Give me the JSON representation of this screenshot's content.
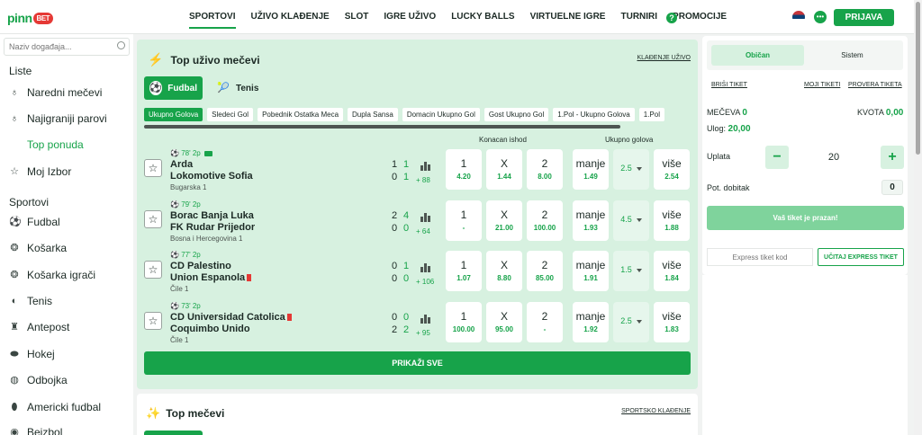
{
  "header": {
    "logo_text": "pinn",
    "logo_badge": "BET",
    "nav": [
      "SPORTOVI",
      "UŽIVO KLAĐENJE",
      "SLOT",
      "IGRE UŽIVO",
      "LUCKY BALLS",
      "VIRTUELNE IGRE",
      "TURNIRI",
      "PROMOCIJE"
    ],
    "help_glyph": "?",
    "login_label": "PRIJAVA"
  },
  "sidebar": {
    "search_placeholder": "Naziv događaja...",
    "lists_title": "Liste",
    "list_items": [
      "Naredni mečevi",
      "Najigraniji parovi",
      "Top ponuda",
      "Moj Izbor"
    ],
    "sports_title": "Sportovi",
    "sports": [
      "Fudbal",
      "Košarka",
      "Košarka igrači",
      "Tenis",
      "Antepost",
      "Hokej",
      "Odbojka",
      "Americki fudbal",
      "Bejzbol"
    ]
  },
  "live": {
    "title": "Top uživo mečevi",
    "link": "KLAĐENJE UŽIVO",
    "sports": [
      "Fudbal",
      "Tenis"
    ],
    "market_tabs": [
      "Ukupno Golova",
      "Sledeci Gol",
      "Pobednik Ostatka Meca",
      "Dupla Sansa",
      "Domacin Ukupno Gol",
      "Gost Ukupno Gol",
      "1.Pol - Ukupno Golova",
      "1.Pol"
    ],
    "col_final": "Konacan ishod",
    "col_goals": "Ukupno golova",
    "matches": [
      {
        "time": "78' 2p",
        "home": "Arda",
        "away": "Lokomotive Sofia",
        "league": "Bugarska 1",
        "h1": "1",
        "h2": "1",
        "a1": "0",
        "a2": "1",
        "more": "+ 88",
        "o1": "4.20",
        "ox": "1.44",
        "o2": "8.00",
        "under": "1.49",
        "line": "2.5",
        "over": "2.54"
      },
      {
        "time": "79' 2p",
        "home": "Borac Banja Luka",
        "away": "FK Rudar Prijedor",
        "league": "Bosna i Hercegovina 1",
        "h1": "2",
        "h2": "4",
        "a1": "0",
        "a2": "0",
        "more": "+ 64",
        "o1": "-",
        "ox": "21.00",
        "o2": "100.00",
        "under": "1.93",
        "line": "4.5",
        "over": "1.88"
      },
      {
        "time": "77' 2p",
        "home": "CD Palestino",
        "away": "Union Espanola",
        "league": "Čile 1",
        "h1": "0",
        "h2": "1",
        "a1": "0",
        "a2": "0",
        "more": "+ 106",
        "o1": "1.07",
        "ox": "8.80",
        "o2": "85.00",
        "under": "1.91",
        "line": "1.5",
        "over": "1.84"
      },
      {
        "time": "73' 2p",
        "home": "CD Universidad Catolica",
        "away": "Coquimbo Unido",
        "league": "Čile 1",
        "h1": "0",
        "h2": "0",
        "a1": "2",
        "a2": "2",
        "more": "+ 95",
        "o1": "100.00",
        "ox": "95.00",
        "o2": "-",
        "under": "1.92",
        "line": "2.5",
        "over": "1.83"
      }
    ],
    "label_1": "1",
    "label_x": "X",
    "label_2": "2",
    "label_under": "manje",
    "label_over": "više",
    "show_all": "PRIKAŽI SVE"
  },
  "top": {
    "title": "Top mečevi",
    "link": "SPORTSKO KLAĐENJE"
  },
  "ticket": {
    "tabs": [
      "Običan",
      "Sistem"
    ],
    "clear": "BRIŠI TIKET",
    "my_tickets": "MOJI TIKETI",
    "check": "PROVERA TIKETA",
    "matches_label": "MEČEVA",
    "matches_value": "0",
    "odds_label": "KVOTA",
    "odds_value": "0,00",
    "stake_label": "Ulog:",
    "stake_value": "20,00",
    "payment_label": "Uplata",
    "minus": "−",
    "plus": "+",
    "amount": "20",
    "pot_label": "Pot. dobitak",
    "pot_value": "0",
    "empty_label": "Vaš tiket je prazan!",
    "express_placeholder": "Express tiket kod",
    "express_btn": "UČITAJ EXPRESS TIKET"
  },
  "colors": {
    "accent": "#17a34a",
    "live_bg": "#d7f1e0"
  }
}
